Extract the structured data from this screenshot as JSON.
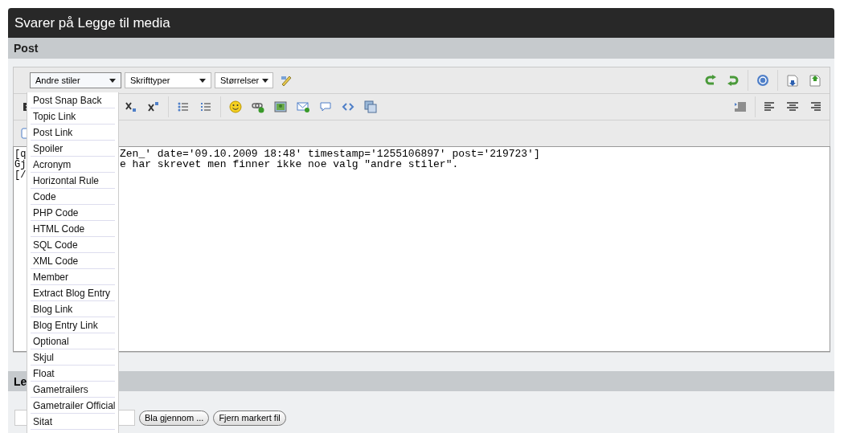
{
  "title": "Svarer på Legge til media",
  "section": "Post",
  "selects": [
    {
      "label": "Andre stiler",
      "open": true
    },
    {
      "label": "Skrifttyper",
      "open": false
    },
    {
      "label": "Størrelser",
      "open": false
    }
  ],
  "editor_lines": [
    {
      "left": "[q",
      "right": "Zen_' date='09.10.2009 18:48' timestamp='1255106897' post='219723']"
    },
    {
      "left": "Gj",
      "right": "e har skrevet men finner ikke noe valg \"andre stiler\"."
    },
    {
      "left": "[/"
    }
  ],
  "styles_menu": [
    {
      "label": "Post Snap Back"
    },
    {
      "label": "Topic Link"
    },
    {
      "label": "Post Link"
    },
    {
      "label": "Spoiler"
    },
    {
      "label": "Acronym"
    },
    {
      "label": "Horizontal Rule"
    },
    {
      "label": "Code"
    },
    {
      "label": "PHP Code"
    },
    {
      "label": "HTML Code"
    },
    {
      "label": "SQL Code"
    },
    {
      "label": "XML Code"
    },
    {
      "label": "Member"
    },
    {
      "label": "Extract Blog Entry"
    },
    {
      "label": "Blog Link"
    },
    {
      "label": "Blog Entry Link"
    },
    {
      "label": "Optional"
    },
    {
      "label": "Skjul"
    },
    {
      "label": "Float"
    },
    {
      "label": "Gametrailers"
    },
    {
      "label": "Gametrailer Official"
    },
    {
      "label": "Sitat"
    }
  ],
  "attachments": {
    "header": "Le",
    "buttons": [
      "Bla gjennom ...",
      "Fjern markert fil"
    ]
  }
}
